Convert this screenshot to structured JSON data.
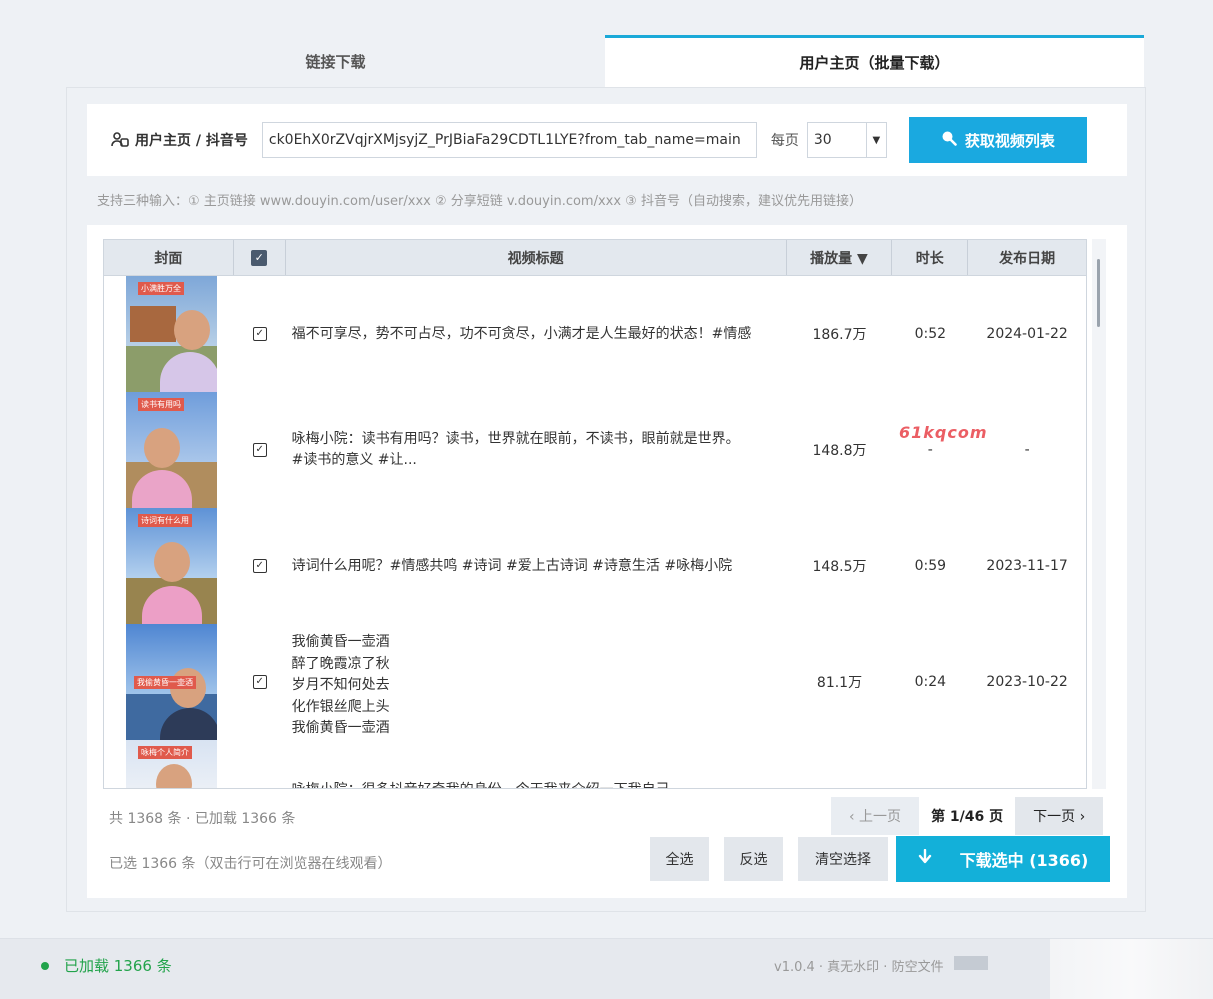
{
  "tabs": [
    {
      "label": "链接下载",
      "active": false
    },
    {
      "label": "用户主页（批量下载）",
      "active": true
    }
  ],
  "search": {
    "label": "用户主页 / 抖音号",
    "url_value": "ck0EhX0rZVqjrXMjsyjZ_PrJBiaFa29CDTL1LYE?from_tab_name=main",
    "per_page_label": "每页",
    "per_page_value": "30",
    "fetch_button": "获取视频列表"
  },
  "hint": "支持三种输入：① 主页链接 www.douyin.com/user/xxx  ② 分享短链 v.douyin.com/xxx  ③ 抖音号（自动搜索，建议优先用链接）",
  "table": {
    "headers": {
      "cover": "封面",
      "title": "视频标题",
      "plays": "播放量 ▼",
      "duration": "时长",
      "date": "发布日期"
    },
    "rows": [
      {
        "title": "福不可享尽，势不可占尽，功不可贪尽，小满才是人生最好的状态！#情感",
        "plays": "186.7万",
        "duration": "0:52",
        "date": "2024-01-22",
        "cover_caption": "小满胜万全"
      },
      {
        "title": "咏梅小院：读书有用吗？读书，世界就在眼前，不读书，眼前就是世界。\n#读书的意义 #让...",
        "plays": "148.8万",
        "duration": "-",
        "date": "-",
        "cover_caption": "读书有用吗"
      },
      {
        "title": "诗词什么用呢？#情感共鸣 #诗词 #爱上古诗词 #诗意生活 #咏梅小院",
        "plays": "148.5万",
        "duration": "0:59",
        "date": "2023-11-17",
        "cover_caption": "诗词有什么用"
      },
      {
        "title": "我偷黄昏一壶酒\n醉了晚霞凉了秋\n岁月不知何处去\n化作银丝爬上头\n我偷黄昏一壶酒\n世间",
        "plays": "81.1万",
        "duration": "0:24",
        "date": "2023-10-22",
        "cover_caption": "我偷黄昏一壶酒"
      },
      {
        "title": "咏梅小院：很多抖音好奇我的身份，今天我来介绍一下我自己",
        "plays": "",
        "duration": "",
        "date": "",
        "cover_caption": "咏梅个人简介"
      }
    ]
  },
  "watermark": "61kqcom",
  "summary": "共 1368 条 · 已加载 1366 条",
  "pager": {
    "prev": "‹ 上一页",
    "info": "第 1/46 页",
    "next": "下一页 ›"
  },
  "selected_info": "已选 1366 条（双击行可在浏览器在线观看）",
  "actions": {
    "select_all": "全选",
    "invert": "反选",
    "clear": "清空选择",
    "download": "下载选中 (1366)"
  },
  "status": {
    "text": "已加载 1366 条",
    "version": "v1.0.4 · 真无水印 · 防空文件"
  },
  "colors": {
    "accent": "#1aa9e0",
    "download": "#13b0d9",
    "status_ok": "#22a34b",
    "watermark": "#e8434a"
  }
}
